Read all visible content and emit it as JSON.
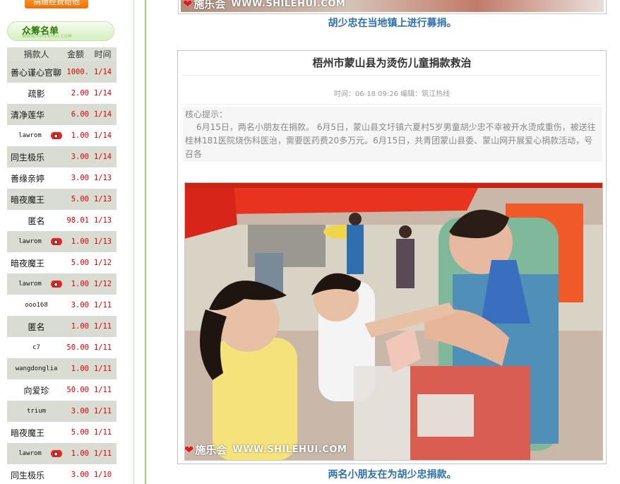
{
  "sidebar": {
    "donate_button": "捐赠经费给他",
    "donor_list_title": "众筹名单",
    "donor_list_subtitle": "WWW.SHILEHUI.COM",
    "columns": [
      "捐款人",
      "金额",
      "时间"
    ],
    "rows": [
      {
        "name": "善心谨心官聊",
        "amount": "1000.",
        "time": "1/14",
        "weibo": false
      },
      {
        "name": "疏影",
        "amount": "2.00",
        "time": "1/14",
        "weibo": false
      },
      {
        "name": "清净莲华",
        "amount": "6.00",
        "time": "1/14",
        "weibo": false
      },
      {
        "name": "lawrom",
        "amount": "1.00",
        "time": "1/14",
        "weibo": true
      },
      {
        "name": "同生极乐",
        "amount": "3.00",
        "time": "1/14",
        "weibo": false
      },
      {
        "name": "善缘亲婷",
        "amount": "3.00",
        "time": "1/13",
        "weibo": false
      },
      {
        "name": "暗夜魔王",
        "amount": "5.00",
        "time": "1/13",
        "weibo": false
      },
      {
        "name": "匿名",
        "amount": "98.01",
        "time": "1/13",
        "weibo": false
      },
      {
        "name": "lawrom",
        "amount": "1.00",
        "time": "1/13",
        "weibo": true
      },
      {
        "name": "暗夜魔王",
        "amount": "5.00",
        "time": "1/12",
        "weibo": false
      },
      {
        "name": "lawrom",
        "amount": "1.00",
        "time": "1/12",
        "weibo": true
      },
      {
        "name": "ooo168",
        "amount": "3.00",
        "time": "1/11",
        "weibo": false
      },
      {
        "name": "匿名",
        "amount": "1.00",
        "time": "1/11",
        "weibo": false
      },
      {
        "name": "c7",
        "amount": "50.00",
        "time": "1/11",
        "weibo": false
      },
      {
        "name": "wangdonglia",
        "amount": "1.00",
        "time": "1/11",
        "weibo": false
      },
      {
        "name": "向爱珍",
        "amount": "50.00",
        "time": "1/11",
        "weibo": false
      },
      {
        "name": "trium",
        "amount": "3.00",
        "time": "1/11",
        "weibo": false
      },
      {
        "name": "暗夜魔王",
        "amount": "5.00",
        "time": "1/11",
        "weibo": false
      },
      {
        "name": "lawrom",
        "amount": "1.00",
        "time": "1/11",
        "weibo": true
      },
      {
        "name": "同生极乐",
        "amount": "3.00",
        "time": "1/10",
        "weibo": false
      }
    ]
  },
  "article": {
    "top_caption": "胡少忠在当地镇上进行募捐。",
    "screenshot": {
      "title": "梧州市蒙山县为烫伤儿童捐款救治",
      "meta": "时间：06-18 09:26  编辑：筑江热线",
      "summary_label": "核心提示：",
      "summary_text": "6月15日，两名小朋友在捐款。 6月5日，蒙山县文圩镇六夏村5岁男童胡少忠不幸被开水烫成重伤，被送往桂林181医院烧伤科医治，需要医药费20多万元。6月15日，共青团蒙山县委、蒙山网开展爱心捐款活动，号召各"
    },
    "watermark": {
      "brand": "施乐会",
      "site": "WWW.SHILEHUI.COM"
    },
    "bottom_caption": "两名小朋友在为胡少忠捐款。"
  },
  "colors": {
    "accent_green": "#2b7b0a",
    "caption_blue": "#2e6fb0",
    "amount_red": "#e00000",
    "button_orange": "#ee6f05"
  },
  "icons": {
    "weibo": "weibo-icon",
    "heart": "heart-logo-icon"
  }
}
